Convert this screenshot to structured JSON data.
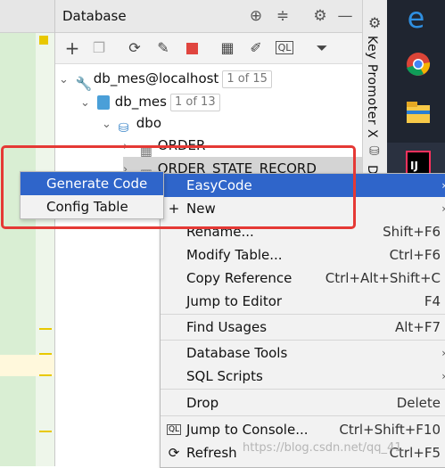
{
  "panel": {
    "title": "Database",
    "header_icons": [
      "crosshair-icon",
      "collapse-icon",
      "gear-icon",
      "minimize-icon"
    ],
    "toolbar_icons": [
      "add-icon",
      "copy-icon",
      "refresh-icon",
      "edit-schema-icon",
      "stop-icon",
      "table-icon",
      "pencil-icon",
      "sql-console-icon",
      "filter-icon"
    ]
  },
  "tree": {
    "datasource": {
      "label": "db_mes@localhost",
      "badge": "1 of 15"
    },
    "database": {
      "label": "db_mes",
      "badge": "1 of 13"
    },
    "schema": {
      "label": "dbo"
    },
    "tables": [
      {
        "label": "ORDER"
      },
      {
        "label": "ORDER_STATE_RECORD"
      }
    ]
  },
  "submenu": {
    "items": [
      {
        "label": "Generate Code",
        "selected": true
      },
      {
        "label": "Config Table",
        "selected": false
      }
    ]
  },
  "context_menu": {
    "items": [
      {
        "label": "EasyCode",
        "shortcut": "",
        "selected": true,
        "icon": ""
      },
      {
        "label": "New",
        "shortcut": "",
        "selected": false,
        "icon": "plus-icon"
      },
      {
        "label": "Rename...",
        "shortcut": "Shift+F6"
      },
      {
        "label": "Modify Table...",
        "shortcut": "Ctrl+F6"
      },
      {
        "label": "Copy Reference",
        "shortcut": "Ctrl+Alt+Shift+C"
      },
      {
        "label": "Jump to Editor",
        "shortcut": "F4"
      },
      {
        "label": "Find Usages",
        "shortcut": "Alt+F7"
      },
      {
        "label": "Database Tools",
        "shortcut": ""
      },
      {
        "label": "SQL Scripts",
        "shortcut": ""
      },
      {
        "label": "Drop",
        "shortcut": "Delete"
      },
      {
        "label": "Jump to Console...",
        "shortcut": "Ctrl+Shift+F10"
      },
      {
        "label": "Refresh",
        "shortcut": "Ctrl+F5"
      }
    ]
  },
  "side_strip": {
    "label": "Key Promoter X",
    "label2": "D"
  },
  "taskbar": {
    "icons": [
      "edge-icon",
      "chrome-icon",
      "file-explorer-icon",
      "intellij-icon"
    ]
  },
  "watermark": "https://blog.csdn.net/qq_41"
}
